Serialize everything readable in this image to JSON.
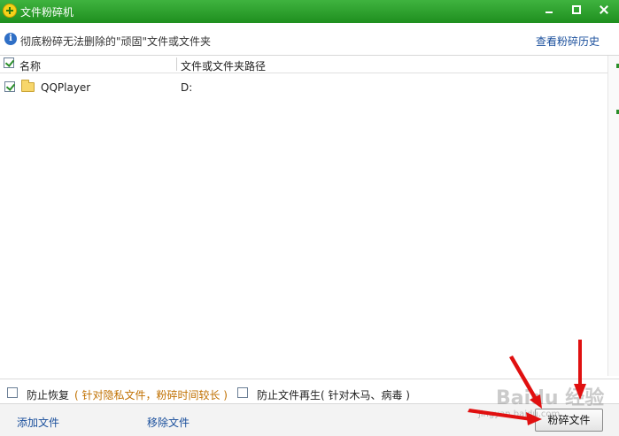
{
  "window": {
    "title": "文件粉碎机"
  },
  "infobar": {
    "text": "彻底粉碎无法删除的\"顽固\"文件或文件夹",
    "history_link": "查看粉碎历史"
  },
  "table": {
    "headers": {
      "name": "名称",
      "path": "文件或文件夹路径"
    },
    "rows": [
      {
        "name": "QQPlayer",
        "path": "D:",
        "checked": true
      }
    ]
  },
  "options": {
    "prevent_recovery": {
      "label": "防止恢复",
      "hint": "( 针对隐私文件，粉碎时间较长 )",
      "checked": false
    },
    "prevent_regen": {
      "label": "防止文件再生",
      "hint": "( 针对木马、病毒 )",
      "checked": false
    }
  },
  "bottombar": {
    "add_file": "添加文件",
    "remove_file": "移除文件",
    "shred_button": "粉碎文件"
  },
  "watermark": {
    "text": "Baidu 经验",
    "sub": "jingyan.baidu.com"
  },
  "colors": {
    "title_bar": "#2a9e2a",
    "link": "#1a4f9c",
    "hint_orange": "#c07000",
    "arrow": "#e01010"
  }
}
